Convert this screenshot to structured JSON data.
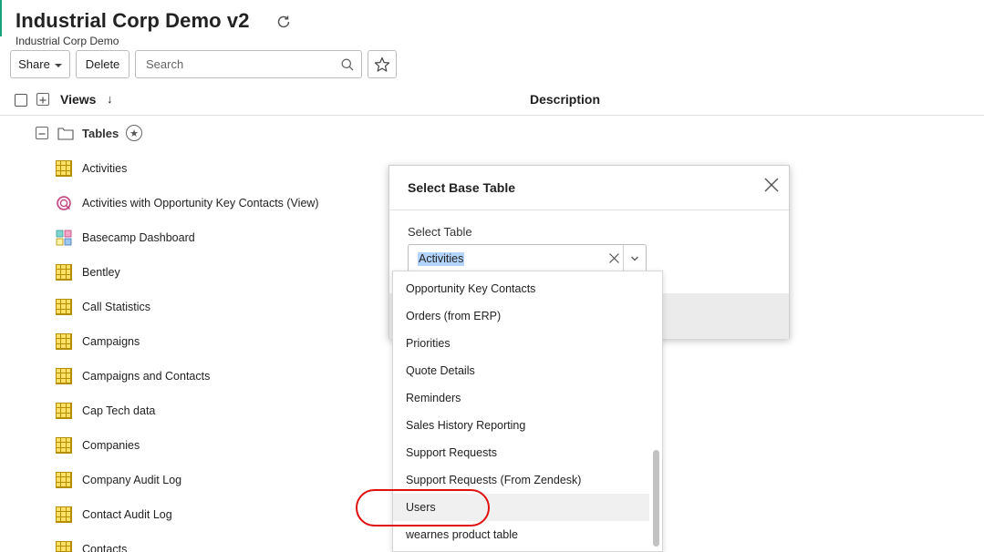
{
  "header": {
    "title": "Industrial Corp Demo v2",
    "subtitle": "Industrial Corp Demo"
  },
  "toolbar": {
    "share_label": "Share",
    "delete_label": "Delete",
    "search_placeholder": "Search"
  },
  "table_header": {
    "views_label": "Views",
    "sort_indicator": "↓",
    "description_label": "Description"
  },
  "folder": {
    "label": "Tables"
  },
  "views": [
    {
      "label": "Activities",
      "icon": "table-icon"
    },
    {
      "label": "Activities with Opportunity Key Contacts (View)",
      "icon": "query-view-icon"
    },
    {
      "label": "Basecamp Dashboard",
      "icon": "dashboard-icon"
    },
    {
      "label": "Bentley",
      "icon": "table-icon"
    },
    {
      "label": "Call Statistics",
      "icon": "table-icon"
    },
    {
      "label": "Campaigns",
      "icon": "table-icon"
    },
    {
      "label": "Campaigns and Contacts",
      "icon": "table-icon"
    },
    {
      "label": "Cap Tech data",
      "icon": "table-icon"
    },
    {
      "label": "Companies",
      "icon": "table-icon"
    },
    {
      "label": "Company Audit Log",
      "icon": "table-icon"
    },
    {
      "label": "Contact Audit Log",
      "icon": "table-icon"
    },
    {
      "label": "Contacts",
      "icon": "table-icon"
    }
  ],
  "dialog": {
    "title": "Select Base Table",
    "field_label": "Select Table",
    "selected_value": "Activities"
  },
  "dropdown": {
    "options": [
      "Opportunity Key Contacts",
      "Orders (from ERP)",
      "Priorities",
      "Quote Details",
      "Reminders",
      "Sales History Reporting",
      "Support Requests",
      "Support Requests (From Zendesk)",
      "Users",
      "wearnes product table"
    ],
    "hovered_option": "Users"
  },
  "colors": {
    "accent": "#1aa37a",
    "highlight_oval": "#e01010",
    "selection": "#b3d4fc",
    "table_icon": "#ffe066"
  }
}
